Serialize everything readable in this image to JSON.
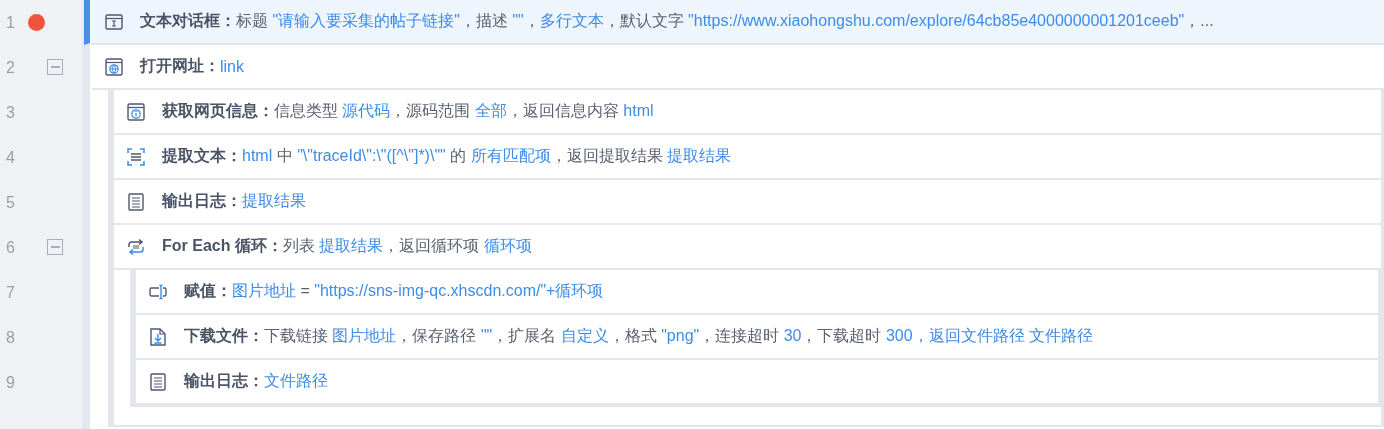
{
  "steps": [
    {
      "line": "1",
      "kind": "dialog",
      "breakpoint": true,
      "selected": true,
      "title": "文本对话框：",
      "segments": [
        {
          "kind": "plain",
          "text": "标题 "
        },
        {
          "kind": "value",
          "text": "\"请输入要采集的帖子链接\""
        },
        {
          "kind": "plain",
          "text": "，描述 "
        },
        {
          "kind": "value",
          "text": "\"\""
        },
        {
          "kind": "plain",
          "text": "，"
        },
        {
          "kind": "value",
          "text": "多行文本"
        },
        {
          "kind": "plain",
          "text": "，默认文字 "
        },
        {
          "kind": "value",
          "text": "\"https://www.xiaohongshu.com/explore/64cb85e4000000001201ceeb\""
        },
        {
          "kind": "plain",
          "text": "，..."
        }
      ]
    },
    {
      "line": "2",
      "kind": "browser",
      "breakpoint": false,
      "selected": false,
      "expanded": true,
      "title": "打开网址：",
      "segments": [
        {
          "kind": "value",
          "text": "link"
        }
      ],
      "children": [
        {
          "line": "3",
          "kind": "info",
          "breakpoint": false,
          "selected": false,
          "title": "获取网页信息：",
          "segments": [
            {
              "kind": "plain",
              "text": "信息类型 "
            },
            {
              "kind": "value",
              "text": "源代码"
            },
            {
              "kind": "plain",
              "text": "，源码范围 "
            },
            {
              "kind": "value",
              "text": "全部"
            },
            {
              "kind": "plain",
              "text": "，返回信息内容 "
            },
            {
              "kind": "value",
              "text": "html"
            }
          ]
        },
        {
          "line": "4",
          "kind": "extract",
          "breakpoint": false,
          "selected": false,
          "title": "提取文本：",
          "segments": [
            {
              "kind": "value",
              "text": "html"
            },
            {
              "kind": "plain",
              "text": " 中 "
            },
            {
              "kind": "value",
              "text": "\"\\\"traceId\\\":\\\"([^\\\"]*)\\\"\""
            },
            {
              "kind": "plain",
              "text": " 的 "
            },
            {
              "kind": "value",
              "text": "所有匹配项"
            },
            {
              "kind": "plain",
              "text": "，返回提取结果 "
            },
            {
              "kind": "value",
              "text": "提取结果"
            }
          ]
        },
        {
          "line": "5",
          "kind": "log",
          "breakpoint": false,
          "selected": false,
          "title": "输出日志：",
          "segments": [
            {
              "kind": "value",
              "text": "提取结果"
            }
          ]
        },
        {
          "line": "6",
          "kind": "loop",
          "breakpoint": false,
          "selected": false,
          "expanded": true,
          "title": "For Each 循环：",
          "segments": [
            {
              "kind": "plain",
              "text": "列表 "
            },
            {
              "kind": "value",
              "text": "提取结果"
            },
            {
              "kind": "plain",
              "text": "，返回循环项 "
            },
            {
              "kind": "value",
              "text": "循环项"
            }
          ],
          "children": [
            {
              "line": "7",
              "kind": "assign",
              "breakpoint": false,
              "selected": false,
              "title": "赋值：",
              "segments": [
                {
                  "kind": "value",
                  "text": "图片地址"
                },
                {
                  "kind": "plain",
                  "text": " = "
                },
                {
                  "kind": "value",
                  "text": "\"https://sns-img-qc.xhscdn.com/\"+循环项"
                }
              ]
            },
            {
              "line": "8",
              "kind": "download",
              "breakpoint": false,
              "selected": false,
              "title": "下载文件：",
              "segments": [
                {
                  "kind": "plain",
                  "text": "下载链接 "
                },
                {
                  "kind": "value",
                  "text": "图片地址"
                },
                {
                  "kind": "plain",
                  "text": "，保存路径 "
                },
                {
                  "kind": "value",
                  "text": "\"\""
                },
                {
                  "kind": "plain",
                  "text": "，扩展名 "
                },
                {
                  "kind": "value",
                  "text": "自定义"
                },
                {
                  "kind": "plain",
                  "text": "，格式 "
                },
                {
                  "kind": "value",
                  "text": "\"png\""
                },
                {
                  "kind": "plain",
                  "text": "，连接超时 "
                },
                {
                  "kind": "value",
                  "text": "30"
                },
                {
                  "kind": "plain",
                  "text": "，下载超时 "
                },
                {
                  "kind": "value",
                  "text": "300，返回文件路径 文件路径"
                }
              ]
            },
            {
              "line": "9",
              "kind": "log",
              "breakpoint": false,
              "selected": false,
              "title": "输出日志：",
              "segments": [
                {
                  "kind": "value",
                  "text": "文件路径"
                }
              ]
            }
          ]
        }
      ]
    }
  ]
}
